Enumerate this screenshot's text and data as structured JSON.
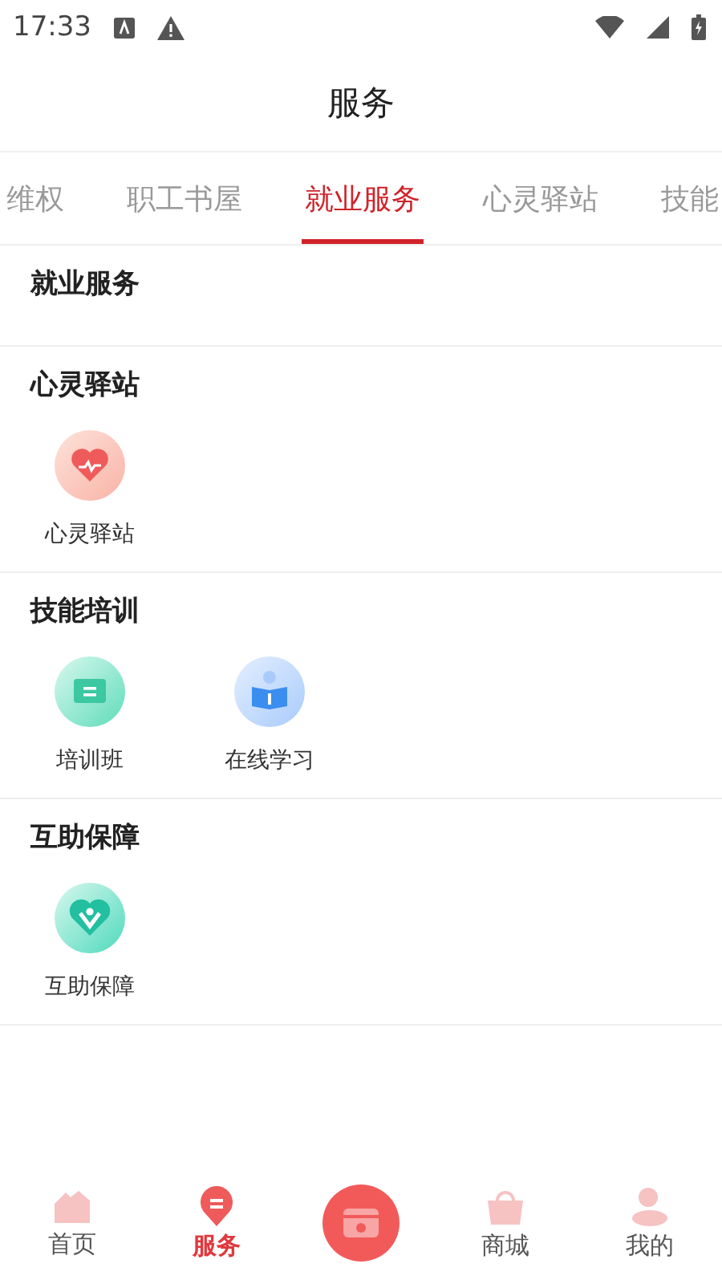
{
  "status_bar": {
    "time": "17:33"
  },
  "header": {
    "title": "服务"
  },
  "tabs": [
    {
      "label": "维权",
      "selected": false
    },
    {
      "label": "职工书屋",
      "selected": false
    },
    {
      "label": "就业服务",
      "selected": true
    },
    {
      "label": "心灵驿站",
      "selected": false
    },
    {
      "label": "技能",
      "selected": false
    }
  ],
  "sections": [
    {
      "title": "就业服务"
    },
    {
      "title": "心灵驿站",
      "items": [
        {
          "label": "心灵驿站",
          "kind": "heart"
        }
      ]
    },
    {
      "title": "技能培训",
      "items": [
        {
          "label": "培训班",
          "kind": "board"
        },
        {
          "label": "在线学习",
          "kind": "reader"
        }
      ]
    },
    {
      "title": "互助保障",
      "items": [
        {
          "label": "互助保障",
          "kind": "care"
        }
      ]
    }
  ],
  "nav": [
    {
      "label": "首页",
      "kind": "home",
      "selected": false
    },
    {
      "label": "服务",
      "kind": "service",
      "selected": true
    },
    {
      "kind": "center",
      "selected": false
    },
    {
      "label": "商城",
      "kind": "shop",
      "selected": false
    },
    {
      "label": "我的",
      "kind": "user",
      "selected": false
    }
  ]
}
